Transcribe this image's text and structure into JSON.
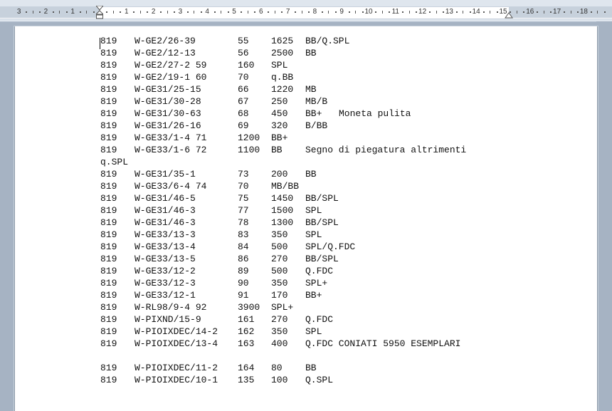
{
  "ruler": {
    "left_numbers": [
      "3",
      "2",
      "1"
    ],
    "right_numbers": [
      "1",
      "2",
      "3",
      "4",
      "5",
      "6",
      "7",
      "8",
      "9",
      "10",
      "11",
      "12",
      "13",
      "14",
      "15",
      "16",
      "17",
      "18"
    ]
  },
  "lines": [
    {
      "a": "819",
      "b": "W-GE2/26-39",
      "c": "55",
      "d": "1625",
      "e": "BB/Q.SPL",
      "f": ""
    },
    {
      "a": "819",
      "b": "W-GE2/12-13",
      "c": "56",
      "d": "2500",
      "e": "BB",
      "f": ""
    },
    {
      "a": "819",
      "b": "W-GE2/27-2 59",
      "c": "160",
      "d": "SPL",
      "e": "",
      "f": ""
    },
    {
      "a": "819",
      "b": "W-GE2/19-1 60",
      "c": "70",
      "d": "q.BB",
      "e": "",
      "f": ""
    },
    {
      "a": "819",
      "b": "W-GE31/25-15",
      "c": "66",
      "d": "1220",
      "e": "MB",
      "f": ""
    },
    {
      "a": "819",
      "b": "W-GE31/30-28",
      "c": "67",
      "d": "250",
      "e": "MB/B",
      "f": ""
    },
    {
      "a": "819",
      "b": "W-GE31/30-63",
      "c": "68",
      "d": "450",
      "e": "BB+",
      "f": "Moneta pulita"
    },
    {
      "a": "819",
      "b": "W-GE31/26-16",
      "c": "69",
      "d": "320",
      "e": "B/BB",
      "f": ""
    },
    {
      "a": "819",
      "b": "W-GE33/1-4 71",
      "c": "1200",
      "d": "BB+",
      "e": "",
      "f": ""
    },
    {
      "a": "819",
      "b": "W-GE33/1-6 72",
      "c": "1100",
      "d": "BB",
      "e": "Segno di piegatura altrimenti",
      "f": ""
    },
    {
      "a": "q.SPL",
      "b": "",
      "c": "",
      "d": "",
      "e": "",
      "f": ""
    },
    {
      "a": "819",
      "b": "W-GE31/35-1",
      "c": "73",
      "d": "200",
      "e": "BB",
      "f": ""
    },
    {
      "a": "819",
      "b": "W-GE33/6-4 74",
      "c": "70",
      "d": "MB/BB",
      "e": "",
      "f": ""
    },
    {
      "a": "819",
      "b": "W-GE31/46-5",
      "c": "75",
      "d": "1450",
      "e": "BB/SPL",
      "f": ""
    },
    {
      "a": "819",
      "b": "W-GE31/46-3",
      "c": "77",
      "d": "1500",
      "e": "SPL",
      "f": ""
    },
    {
      "a": "819",
      "b": "W-GE31/46-3",
      "c": "78",
      "d": "1300",
      "e": "BB/SPL",
      "f": ""
    },
    {
      "a": "819",
      "b": "W-GE33/13-3",
      "c": "83",
      "d": "350",
      "e": "SPL",
      "f": ""
    },
    {
      "a": "819",
      "b": "W-GE33/13-4",
      "c": "84",
      "d": "500",
      "e": "SPL/Q.FDC",
      "f": ""
    },
    {
      "a": "819",
      "b": "W-GE33/13-5",
      "c": "86",
      "d": "270",
      "e": "BB/SPL",
      "f": ""
    },
    {
      "a": "819",
      "b": "W-GE33/12-2",
      "c": "89",
      "d": "500",
      "e": "Q.FDC",
      "f": ""
    },
    {
      "a": "819",
      "b": "W-GE33/12-3",
      "c": "90",
      "d": "350",
      "e": "SPL+",
      "f": ""
    },
    {
      "a": "819",
      "b": "W-GE33/12-1",
      "c": "91",
      "d": "170",
      "e": "BB+",
      "f": ""
    },
    {
      "a": "819",
      "b": "W-RL98/9-4 92",
      "c": "3900",
      "d": "SPL+",
      "e": "",
      "f": ""
    },
    {
      "a": "819",
      "b": "W-PIXND/15-9",
      "c": "161",
      "d": "270",
      "e": "Q.FDC",
      "f": ""
    },
    {
      "a": "819",
      "b": "W-PIOIXDEC/14-2",
      "c": "162",
      "d": "350",
      "e": "SPL",
      "f": ""
    },
    {
      "a": "819",
      "b": "W-PIOIXDEC/13-4",
      "c": "163",
      "d": "400",
      "e": "Q.FDC CONIATI 5950 ESEMPLARI",
      "f": ""
    },
    {
      "a": "",
      "b": "",
      "c": "",
      "d": "",
      "e": "",
      "f": ""
    },
    {
      "a": "819",
      "b": "W-PIOIXDEC/11-2",
      "c": "164",
      "d": "80",
      "e": "BB",
      "f": ""
    },
    {
      "a": "819",
      "b": "W-PIOIXDEC/10-1",
      "c": "135",
      "d": "100",
      "e": "Q.SPL",
      "f": ""
    }
  ]
}
